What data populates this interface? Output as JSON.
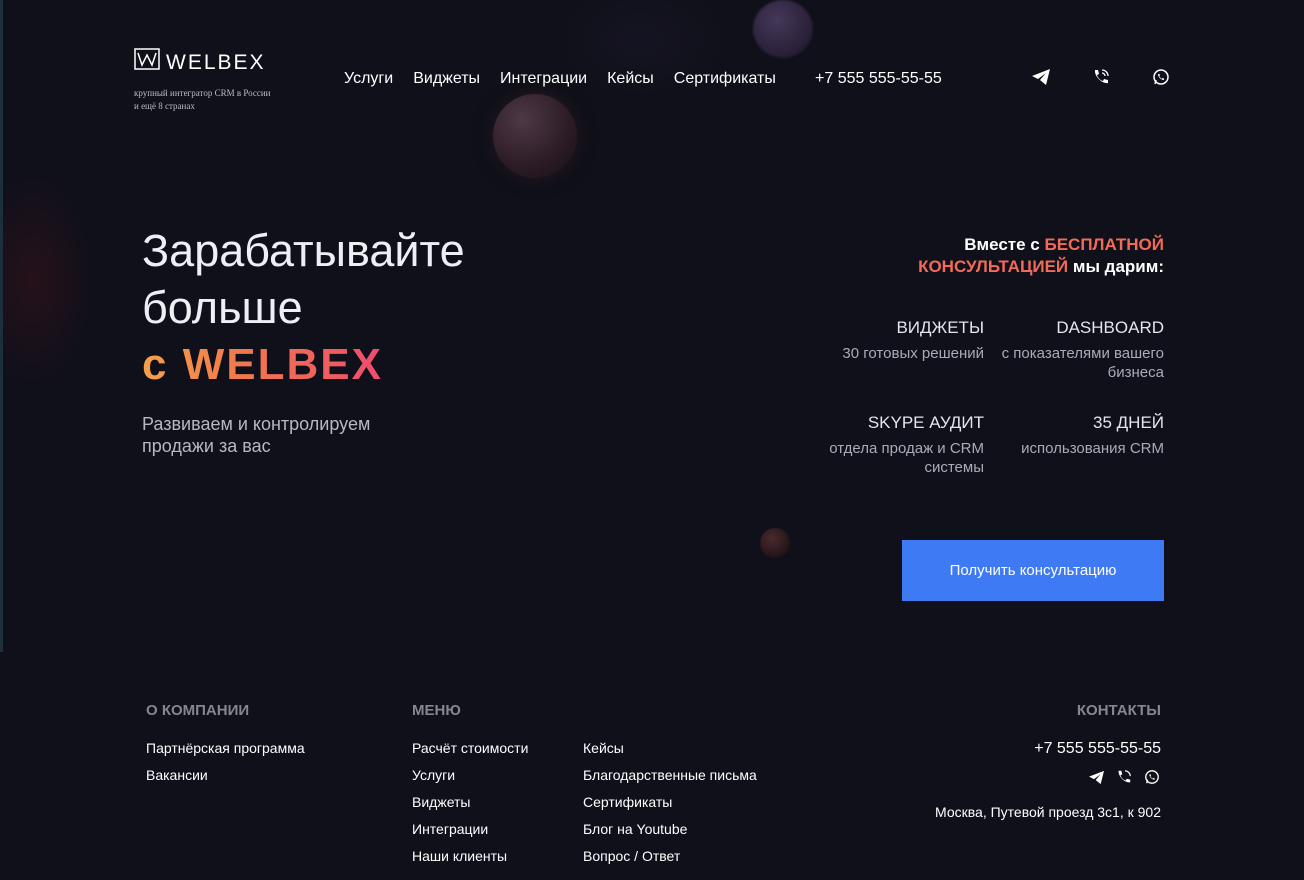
{
  "header": {
    "logo_text": "WELBEX",
    "logo_subtitle": "крупный интегратор CRM в России и ещё 8 странах",
    "nav": [
      "Услуги",
      "Виджеты",
      "Интеграции",
      "Кейсы",
      "Сертификаты"
    ],
    "phone": "+7 555 555-55-55",
    "icons": [
      "telegram-icon",
      "phone-call-icon",
      "whatsapp-icon"
    ]
  },
  "hero": {
    "headline_1": "Зарабатывайте",
    "headline_2": "больше",
    "brand_line": "с WELBEX",
    "subhead": "Развиваем и контролируем продажи за вас",
    "offer_prefix": "Вместе с ",
    "offer_highlight_1": "БЕСПЛАТНОЙ",
    "offer_highlight_2": "КОНСУЛЬТАЦИЕЙ",
    "offer_suffix": " мы дарим:",
    "features": [
      {
        "title": "ВИДЖЕТЫ",
        "desc": "30 готовых решений"
      },
      {
        "title": "DASHBOARD",
        "desc": "с показателями вашего бизнеса"
      },
      {
        "title": "SKYPE АУДИТ",
        "desc": "отдела продаж и CRM системы"
      },
      {
        "title": "35 ДНЕЙ",
        "desc": "использования CRM"
      }
    ],
    "cta_label": "Получить консультацию"
  },
  "footer": {
    "about_heading": "О КОМПАНИИ",
    "about_links": [
      "Партнёрская программа",
      "Вакансии"
    ],
    "menu_heading": "МЕНЮ",
    "menu_col1": [
      "Расчёт стоимости",
      "Услуги",
      "Виджеты",
      "Интеграции",
      "Наши клиенты"
    ],
    "menu_col2": [
      "Кейсы",
      "Благодарственные письма",
      "Сертификаты",
      "Блог на Youtube",
      "Вопрос / Ответ"
    ],
    "contacts_heading": "КОНТАКТЫ",
    "phone": "+7 555 555-55-55",
    "address": "Москва, Путевой проезд 3с1, к 902"
  },
  "colors": {
    "background": "#0f1019",
    "accent_blue": "#3f7af5",
    "gradient_orange": "#f6a04d",
    "gradient_pink": "#ee4c6f"
  }
}
